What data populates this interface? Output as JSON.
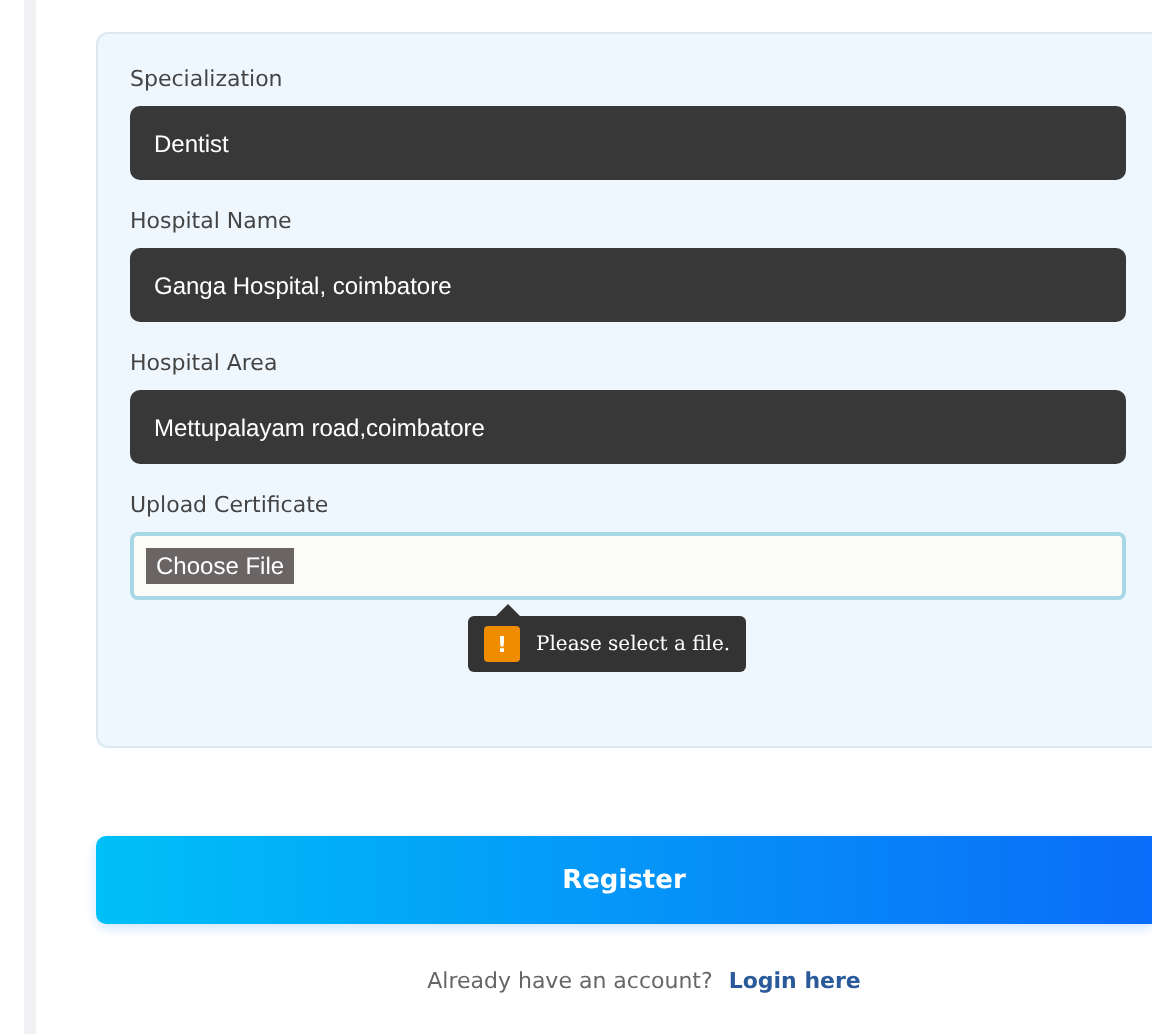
{
  "fields": [
    {
      "kind": "text",
      "label": "Specialization",
      "value": "Dentist"
    },
    {
      "kind": "text",
      "label": "Hospital Name",
      "value": "Ganga Hospital, coimbatore"
    },
    {
      "kind": "text",
      "label": "Hospital Area",
      "value": "Mettupalayam road,coimbatore"
    },
    {
      "kind": "file",
      "label": "Upload Certificate",
      "button": "Choose File",
      "tooltip": {
        "icon": "!",
        "message": "Please select a file."
      }
    }
  ],
  "submit": "Register",
  "footer": {
    "text": "Already have an account?",
    "link": "Login here"
  }
}
